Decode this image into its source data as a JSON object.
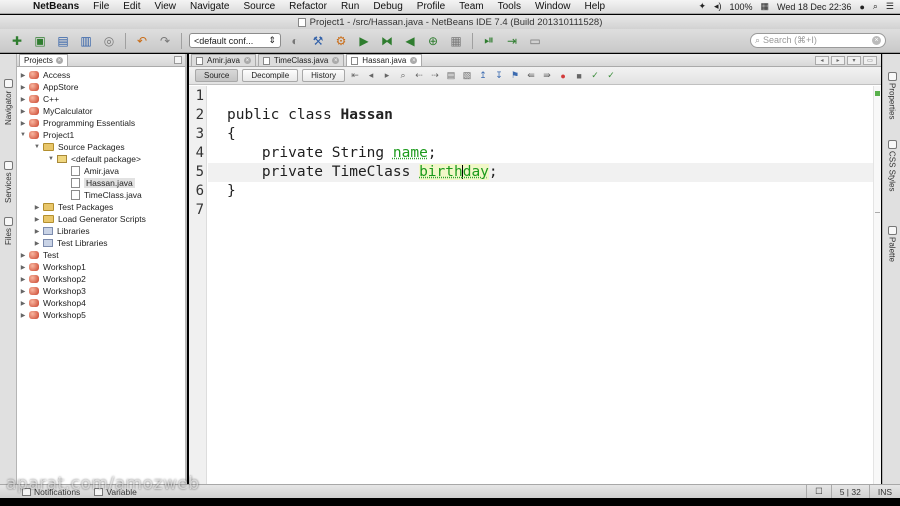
{
  "menubar": {
    "app_name": "NetBeans",
    "items": [
      "File",
      "Edit",
      "View",
      "Navigate",
      "Source",
      "Refactor",
      "Run",
      "Debug",
      "Profile",
      "Team",
      "Tools",
      "Window",
      "Help"
    ],
    "battery": "100%",
    "datetime": "Wed 18 Dec  22:36"
  },
  "window": {
    "title": "Project1 - /src/Hassan.java - NetBeans IDE 7.4 (Build 201310111528)"
  },
  "toolbar": {
    "config_value": "<default conf...",
    "search_placeholder": "Search (⌘+I)"
  },
  "left_strip": {
    "tabs": [
      "Navigator",
      "Services",
      "Files"
    ]
  },
  "right_strip": {
    "tabs": [
      "Properties",
      "CSS Styles",
      "Palette"
    ]
  },
  "projects_panel": {
    "tab_label": "Projects",
    "tree": [
      {
        "label": "Access",
        "icon": "project",
        "level": 0,
        "expanded": false
      },
      {
        "label": "AppStore",
        "icon": "project",
        "level": 0,
        "expanded": false
      },
      {
        "label": "C++",
        "icon": "project",
        "level": 0,
        "expanded": false
      },
      {
        "label": "MyCalculator",
        "icon": "project",
        "level": 0,
        "expanded": false
      },
      {
        "label": "Programming Essentials",
        "icon": "project",
        "level": 0,
        "expanded": false
      },
      {
        "label": "Project1",
        "icon": "project",
        "level": 0,
        "expanded": true
      },
      {
        "label": "Source Packages",
        "icon": "folder",
        "level": 1,
        "expanded": true
      },
      {
        "label": "<default package>",
        "icon": "package",
        "level": 2,
        "expanded": true
      },
      {
        "label": "Amir.java",
        "icon": "java",
        "level": 3,
        "expanded": null
      },
      {
        "label": "Hassan.java",
        "icon": "java",
        "level": 3,
        "expanded": null,
        "selected": true
      },
      {
        "label": "TimeClass.java",
        "icon": "java",
        "level": 3,
        "expanded": null
      },
      {
        "label": "Test Packages",
        "icon": "folder",
        "level": 1,
        "expanded": false
      },
      {
        "label": "Load Generator Scripts",
        "icon": "folder",
        "level": 1,
        "expanded": false
      },
      {
        "label": "Libraries",
        "icon": "library",
        "level": 1,
        "expanded": false
      },
      {
        "label": "Test Libraries",
        "icon": "library",
        "level": 1,
        "expanded": false
      },
      {
        "label": "Test",
        "icon": "project",
        "level": 0,
        "expanded": false
      },
      {
        "label": "Workshop1",
        "icon": "project",
        "level": 0,
        "expanded": false
      },
      {
        "label": "Workshop2",
        "icon": "project",
        "level": 0,
        "expanded": false
      },
      {
        "label": "Workshop3",
        "icon": "project",
        "level": 0,
        "expanded": false
      },
      {
        "label": "Workshop4",
        "icon": "project",
        "level": 0,
        "expanded": false
      },
      {
        "label": "Workshop5",
        "icon": "project",
        "level": 0,
        "expanded": false
      }
    ]
  },
  "editor": {
    "tabs": [
      {
        "label": "Amir.java",
        "active": false
      },
      {
        "label": "TimeClass.java",
        "active": false
      },
      {
        "label": "Hassan.java",
        "active": true
      }
    ],
    "modes": [
      {
        "label": "Source",
        "active": true
      },
      {
        "label": "Decompile",
        "active": false
      },
      {
        "label": "History",
        "active": false
      }
    ],
    "line_numbers": [
      "1",
      "2",
      "3",
      "4",
      "5",
      "6",
      "7"
    ],
    "code": {
      "l2_kw": "public class ",
      "l2_name": "Hassan",
      "l3": "{",
      "l4_kw": "    private String ",
      "l4_field": "name",
      "l4_end": ";",
      "l5_kw": "    private TimeClass ",
      "l5_field_a": "birth",
      "l5_field_b": "day",
      "l5_end": ";",
      "l6": "}"
    }
  },
  "statusbar": {
    "notifications": "Notifications",
    "variables": "Variable",
    "position": "5 | 32",
    "mode": "INS",
    "watermark": "aparat.com/amozweb"
  }
}
